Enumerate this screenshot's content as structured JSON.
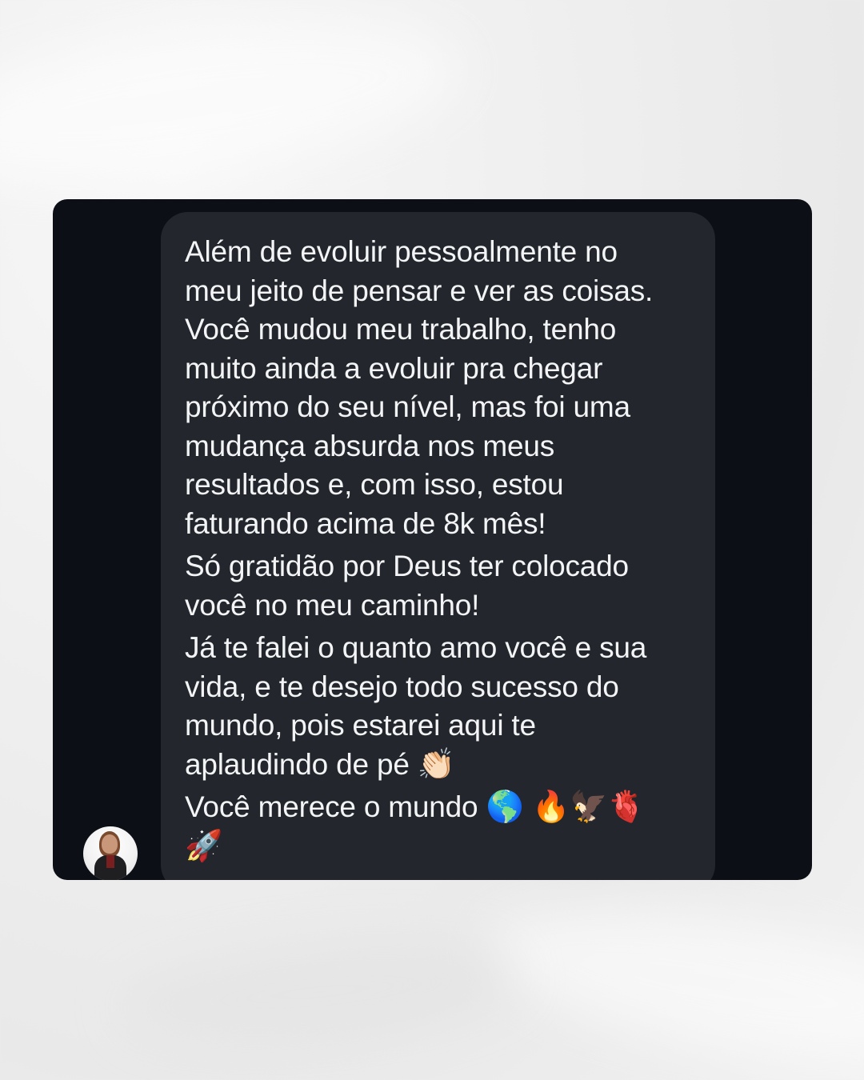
{
  "message": {
    "paragraphs": [
      "Além de evoluir pessoalmente no\nmeu jeito de pensar e ver as coisas.\nVocê mudou meu trabalho, tenho\nmuito ainda a evoluir pra chegar\npróximo do seu nível, mas foi uma\nmudança absurda nos meus\nresultados e, com isso, estou\nfaturando acima de 8k mês!",
      "Só gratidão por Deus ter colocado\nvocê no meu caminho!",
      "Já te falei o quanto amo você e sua\nvida, e te desejo todo sucesso do\nmundo, pois estarei aqui te\naplaudindo de pé"
    ],
    "clap_emoji": "👏🏻",
    "last_line_text": "Você merece o mundo",
    "last_line_emojis": "🌎  🔥🦅🫀",
    "trailing_emoji": "🚀"
  },
  "colors": {
    "card_bg": "#0c0f16",
    "bubble_bg": "#23262c",
    "text": "#f3f4f6"
  },
  "icons": {
    "avatar": "sender-avatar"
  }
}
